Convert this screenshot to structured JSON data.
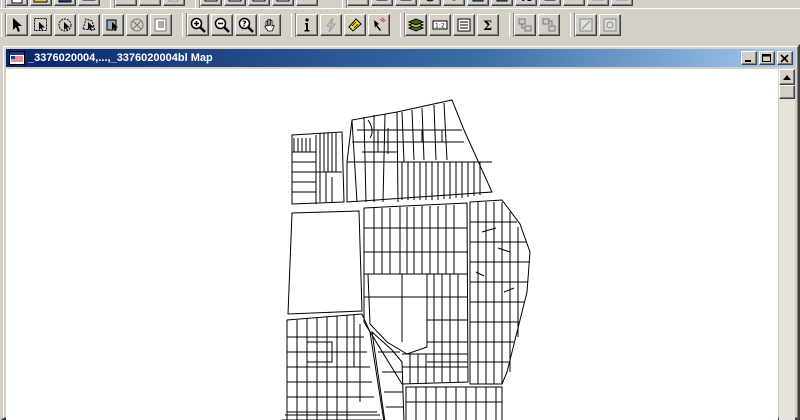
{
  "map_window": {
    "title": "_3376020004,...,_3376020004bl Map"
  },
  "toolbar_top_icons": [
    "new-icon",
    "open-icon",
    "save-icon",
    "print-icon",
    "cut-icon",
    "copy-icon",
    "paste-icon",
    "undo-icon",
    "layer-control-icon",
    "browser-icon",
    "redistrict-icon",
    "legend-icon",
    "graph-icon",
    "query-icon",
    "sql-icon",
    "text-icon"
  ],
  "toolbar_main": {
    "select_tools": [
      "arrow-select-icon",
      "marquee-select-icon",
      "radius-select-icon",
      "polygon-select-icon",
      "boundary-select-icon",
      "unselect-all-icon",
      "invert-selection-icon"
    ],
    "navigation_tools": [
      "zoom-in-icon",
      "zoom-out-icon",
      "change-view-icon",
      "grabber-hand-icon"
    ],
    "analysis_tools": [
      "info-tool-icon",
      "hotlink-icon",
      "label-tool-icon",
      "drag-map-icon"
    ],
    "layer_tools": [
      "layer-control-icon",
      "ruler-icon",
      "statistics-icon",
      "sum-icon"
    ],
    "misc_tools": [
      "create-thematic-icon",
      "map-legend-icon",
      "clip-region-icon",
      "set-clip-icon"
    ]
  },
  "colors": {
    "titlebar_start": "#0a246a",
    "titlebar_end": "#a6caf0",
    "chrome": "#d4d0c8",
    "map_background": "#ffffff",
    "parcel_stroke": "#000000"
  }
}
